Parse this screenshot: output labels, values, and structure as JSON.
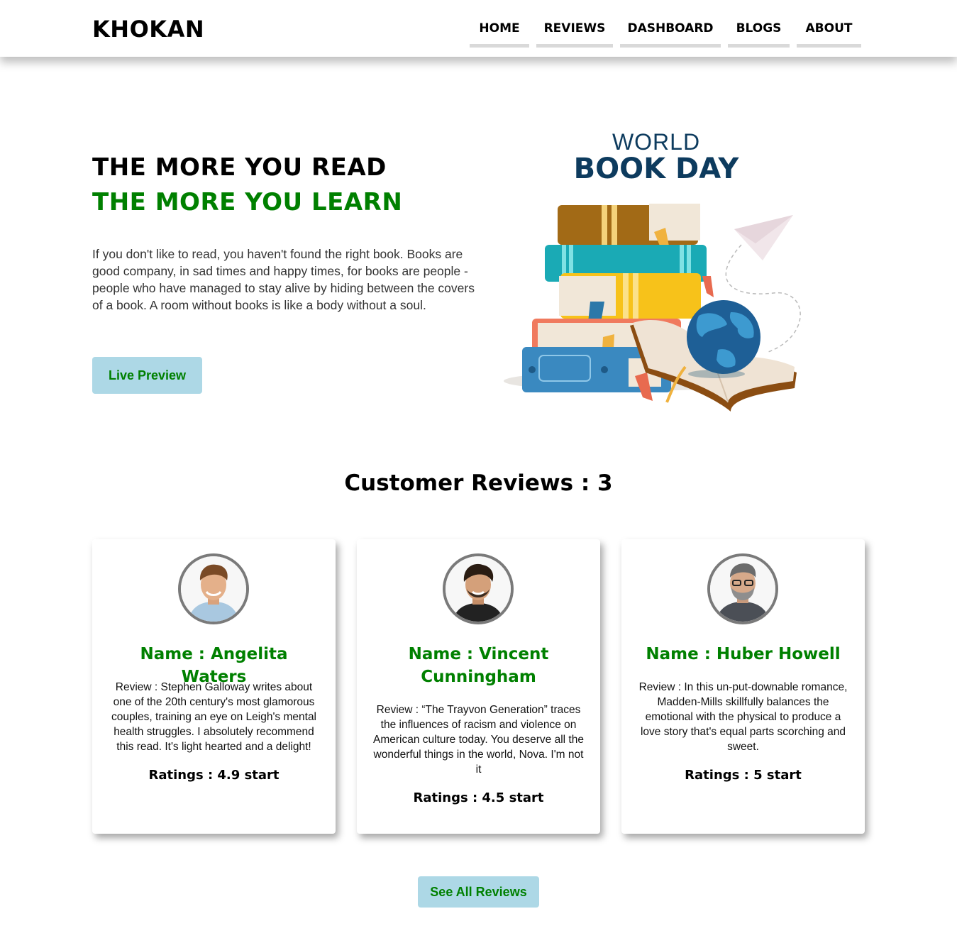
{
  "nav": {
    "brand": "KHOKAN",
    "items": [
      "HOME",
      "REVIEWS",
      "DASHBOARD",
      "BLOGS",
      "ABOUT"
    ]
  },
  "hero": {
    "title_line1": "THE MORE YOU READ",
    "title_line2": "THE MORE YOU LEARN",
    "text": "If you don't like to read, you haven't found the right book. Books are good company, in sad times and happy times, for books are people - people who have managed to stay alive by hiding between the covers of a book. A room without books is like a body without a soul.",
    "button_label": "Live Preview",
    "art_title_small": "WORLD",
    "art_title_big": "BOOK DAY"
  },
  "reviews": {
    "heading": "Customer Reviews : 3",
    "cards": [
      {
        "name": "Name : Angelita Waters",
        "review": "Review : Stephen Galloway writes about one of the 20th century's most glamorous couples, training an eye on Leigh's mental health struggles. I absolutely recommend this read. It's light hearted and a delight!",
        "rating": "Ratings : 4.9 start"
      },
      {
        "name": "Name : Vincent Cunningham",
        "review": "Review : “The Trayvon Generation” traces the influences of racism and violence on American culture today. You deserve all the wonderful things in the world, Nova. I'm not it",
        "rating": "Ratings : 4.5 start"
      },
      {
        "name": "Name : Huber Howell",
        "review": "Review : In this un-put-downable romance, Madden-Mills skillfully balances the emotional with the physical to produce a love story that's equal parts scorching and sweet.",
        "rating": "Ratings : 5 start"
      }
    ],
    "see_all_label": "See All Reviews"
  },
  "colors": {
    "accent_green": "#008000",
    "button_bg": "#add8e6",
    "nav_underline": "#d9d9d9"
  }
}
